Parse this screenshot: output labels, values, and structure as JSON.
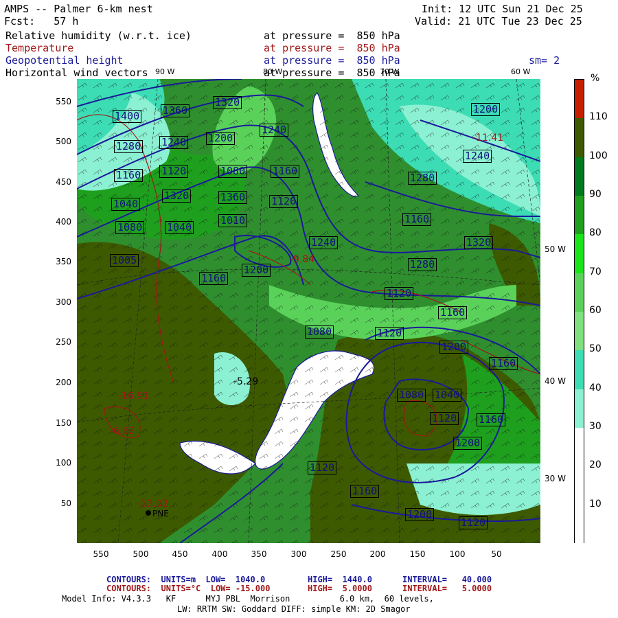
{
  "header": {
    "title": "AMPS -- Palmer 6-km nest",
    "forecast": "Fcst:   57 h",
    "init": "Init: 12 UTC Sun 21 Dec 25",
    "valid": "Valid: 21 UTC Tue 23 Dec 25",
    "smoothing": "sm= 2",
    "fields": [
      {
        "name": "Relative humidity (w.r.t. ice)",
        "level": "at pressure =  850 hPa",
        "color": "#000000"
      },
      {
        "name": "Temperature",
        "level": "at pressure =  850 hPa",
        "color": "#a01818"
      },
      {
        "name": "Geopotential height",
        "level": "at pressure =  850 hPa",
        "color": "#1a1a9a"
      },
      {
        "name": "Horizontal wind vectors",
        "level": "at pressure =  850 hPa",
        "color": "#000000"
      }
    ]
  },
  "map": {
    "y_ticks": [
      "550",
      "500",
      "450",
      "400",
      "350",
      "300",
      "250",
      "200",
      "150",
      "100",
      "50"
    ],
    "x_ticks": [
      "550",
      "500",
      "450",
      "400",
      "350",
      "300",
      "250",
      "200",
      "150",
      "100",
      "50"
    ],
    "lon_top": [
      "90 W",
      "80 W",
      "70 W",
      "60 W"
    ],
    "lon_right": [
      "50 W",
      "40 W",
      "30 W"
    ],
    "station": "PNE",
    "height_labels": [
      "1400",
      "1360",
      "1320",
      "1280",
      "1240",
      "1200",
      "1160",
      "1120",
      "1080",
      "1040",
      "1320",
      "1360",
      "1240",
      "1160",
      "1120",
      "1080",
      "1040",
      "1010",
      "1005",
      "1160",
      "1200",
      "1240",
      "1280",
      "1320",
      "1280",
      "1240",
      "1200",
      "1160",
      "1120",
      "1160",
      "1200",
      "1160",
      "1120",
      "1080",
      "1120",
      "1160",
      "1200",
      "1120",
      "1080",
      "1040",
      "1120",
      "1160",
      "1200"
    ],
    "temp_labels": [
      "-13.02",
      "-16.91",
      "-11.41",
      "-9.84",
      "-6.62",
      "-5.29"
    ],
    "colors": {
      "coast": "#1a1a9a",
      "height_contour": "#1a1a9a",
      "temp_contour": "#a01818",
      "wind": "#111111"
    }
  },
  "colorbar": {
    "unit": "%",
    "labels": [
      "110",
      "100",
      "90",
      "80",
      "70",
      "60",
      "50",
      "40",
      "30",
      "20",
      "10"
    ],
    "colors": [
      "#c81e00",
      "#3d5a00",
      "#007a1e",
      "#1ea01e",
      "#19e619",
      "#5ad25a",
      "#7ee07e",
      "#3cdcb4",
      "#8cf0d2",
      "#ffffff",
      "#ffffff",
      "#ffffff"
    ]
  },
  "footer": {
    "line1": {
      "prefix": "CONTOURS:  UNITS=m  LOW=  1040.0",
      "high": "HIGH=  1440.0",
      "interval": "INTERVAL=   40.000"
    },
    "line2": {
      "prefix": "CONTOURS:  UNITS=°C  LOW= -15.000",
      "high": "HIGH=  5.0000",
      "interval": "INTERVAL=   5.0000"
    },
    "line3": "Model Info: V4.3.3   KF      MYJ PBL  Morrison          6.0 km,  60 levels,",
    "line4": "LW: RRTM SW: Goddard DIFF: simple KM: 2D Smagor"
  }
}
